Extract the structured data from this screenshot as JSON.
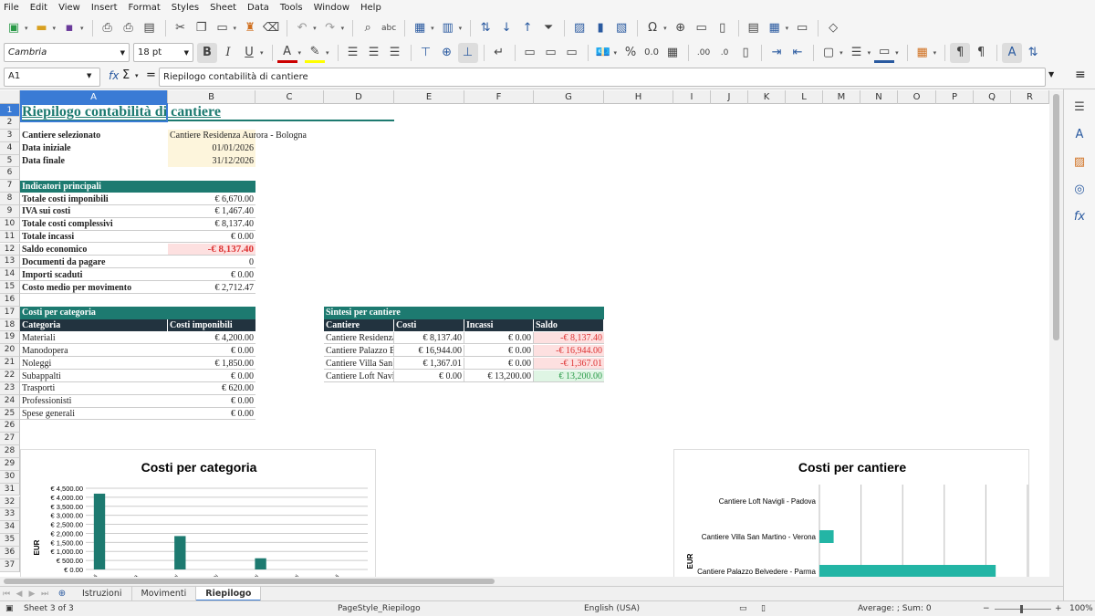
{
  "menu": [
    "File",
    "Edit",
    "View",
    "Insert",
    "Format",
    "Styles",
    "Sheet",
    "Data",
    "Tools",
    "Window",
    "Help"
  ],
  "font_name": "Cambria",
  "font_size": "18 pt",
  "name_box": "A1",
  "formula": "Riepilogo contabilità di cantiere",
  "columns": [
    "A",
    "B",
    "C",
    "D",
    "E",
    "F",
    "G",
    "H",
    "I",
    "J",
    "K",
    "L",
    "M",
    "N",
    "O",
    "P",
    "Q",
    "R"
  ],
  "rows": [
    "1",
    "2",
    "3",
    "4",
    "5",
    "6",
    "7",
    "8",
    "9",
    "10",
    "11",
    "12",
    "13",
    "14",
    "15",
    "16",
    "17",
    "18",
    "19",
    "20",
    "21",
    "22",
    "23",
    "24",
    "25",
    "26",
    "27",
    "28",
    "29",
    "30",
    "31",
    "32",
    "33",
    "34",
    "35",
    "36",
    "37"
  ],
  "sheet": {
    "title": "Riepilogo contabilità di cantiere",
    "cantiere_label": "Cantiere selezionato",
    "cantiere_value": "Cantiere Residenza Aurora - Bologna",
    "data_iniziale_label": "Data iniziale",
    "data_iniziale_value": "01/01/2026",
    "data_finale_label": "Data finale",
    "data_finale_value": "31/12/2026",
    "indicatori_header": "Indicatori principali",
    "indicatori": [
      {
        "label": "Totale costi imponibili",
        "value": "€ 6,670.00"
      },
      {
        "label": "IVA sui costi",
        "value": "€ 1,467.40"
      },
      {
        "label": "Totale costi complessivi",
        "value": "€ 8,137.40"
      },
      {
        "label": "Totale incassi",
        "value": "€ 0.00"
      },
      {
        "label": "Saldo economico",
        "value": "-€ 8,137.40"
      },
      {
        "label": "Documenti da pagare",
        "value": "0"
      },
      {
        "label": "Importi scaduti",
        "value": "€ 0.00"
      },
      {
        "label": "Costo medio per movimento",
        "value": "€ 2,712.47"
      }
    ],
    "categoria_header": "Costi per categoria",
    "categoria_cols": [
      "Categoria",
      "Costi imponibili"
    ],
    "categorie": [
      {
        "name": "Materiali",
        "value": "€ 4,200.00"
      },
      {
        "name": "Manodopera",
        "value": "€ 0.00"
      },
      {
        "name": "Noleggi",
        "value": "€ 1,850.00"
      },
      {
        "name": "Subappalti",
        "value": "€ 0.00"
      },
      {
        "name": "Trasporti",
        "value": "€ 620.00"
      },
      {
        "name": "Professionisti",
        "value": "€ 0.00"
      },
      {
        "name": "Spese generali",
        "value": "€ 0.00"
      }
    ],
    "sintesi_header": "Sintesi per cantiere",
    "sintesi_cols": [
      "Cantiere",
      "Costi",
      "Incassi",
      "Saldo"
    ],
    "sintesi": [
      {
        "cantiere": "Cantiere Residenza Aurora - Bologna",
        "costi": "€ 8,137.40",
        "incassi": "€ 0.00",
        "saldo": "-€ 8,137.40",
        "sign": "neg"
      },
      {
        "cantiere": "Cantiere Palazzo Belvedere - Parma",
        "costi": "€ 16,944.00",
        "incassi": "€ 0.00",
        "saldo": "-€ 16,944.00",
        "sign": "neg"
      },
      {
        "cantiere": "Cantiere Villa San Martino - Verona",
        "costi": "€ 1,367.01",
        "incassi": "€ 0.00",
        "saldo": "-€ 1,367.01",
        "sign": "neg"
      },
      {
        "cantiere": "Cantiere Loft Navigli - Padova",
        "costi": "€ 0.00",
        "incassi": "€ 13,200.00",
        "saldo": "€ 13,200.00",
        "sign": "pos"
      }
    ]
  },
  "chart_data": [
    {
      "type": "bar",
      "title": "Costi per categoria",
      "ylabel": "EUR",
      "xlabel": "",
      "categories": [
        "Materiali",
        "Manodopera",
        "Noleggi",
        "Subappalti",
        "Trasporti",
        "Professionisti",
        "Spese generali"
      ],
      "values": [
        4200,
        0,
        1850,
        0,
        620,
        0,
        0
      ],
      "ylim": [
        0,
        4500
      ],
      "yticks": [
        "€ 0.00",
        "€ 500.00",
        "€ 1,000.00",
        "€ 1,500.00",
        "€ 2,000.00",
        "€ 2,500.00",
        "€ 3,000.00",
        "€ 3,500.00",
        "€ 4,000.00",
        "€ 4,500.00"
      ],
      "color": "#1d7a70",
      "grid": true
    },
    {
      "type": "bar",
      "orientation": "horizontal",
      "title": "Costi per cantiere",
      "ylabel": "EUR",
      "categories": [
        "Cantiere Loft Navigli - Padova",
        "Cantiere Villa San Martino - Verona",
        "Cantiere Palazzo Belvedere - Parma"
      ],
      "values": [
        0,
        1367.01,
        16944
      ],
      "xlim": [
        0,
        20000
      ],
      "color": "#23b5a5",
      "grid": true
    }
  ],
  "tabs": [
    "Istruzioni",
    "Movimenti",
    "Riepilogo"
  ],
  "status": {
    "sheet": "Sheet 3 of 3",
    "pagestyle": "PageStyle_Riepilogo",
    "language": "English (USA)",
    "sum": "Average: ; Sum: 0",
    "zoom": "100%"
  }
}
